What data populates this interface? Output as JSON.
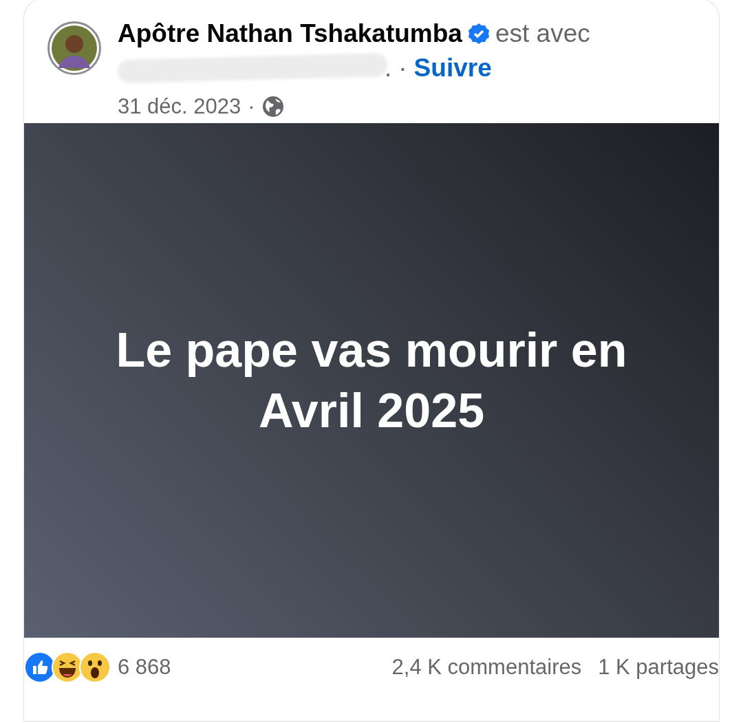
{
  "author": {
    "name": "Apôtre Nathan Tshakatumba",
    "verified": true,
    "with_text": "est avec",
    "tail": ".",
    "separator": "·",
    "follow": "Suivre"
  },
  "date": "31 déc. 2023",
  "date_separator": "·",
  "post": {
    "text": "Le pape vas mourir en Avril 2025"
  },
  "footer": {
    "reactions": [
      {
        "kind": "like"
      },
      {
        "kind": "haha"
      },
      {
        "kind": "wow"
      }
    ],
    "reaction_count": "6 868",
    "comments": "2,4 K commentaires",
    "shares": "1 K partages"
  }
}
